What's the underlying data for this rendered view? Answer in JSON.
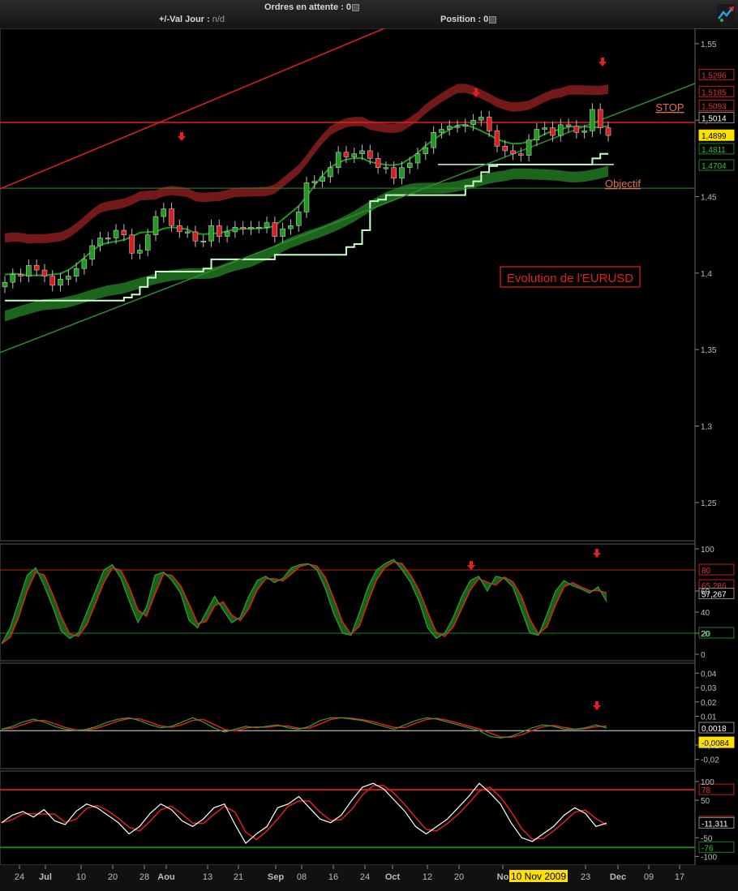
{
  "toolbar": {
    "orders_label": "Ordres en attente :",
    "orders_value": "0",
    "day_change_label": "+/-Val Jour :",
    "day_change_value": "n/d",
    "position_label": "Position :",
    "position_value": "0"
  },
  "colors": {
    "bullish": "#1f9a1f",
    "bearish": "#d42020",
    "stop_line": "#e02020",
    "objective_line": "#2e8b2e",
    "trend_channel_red": "#e02020",
    "trend_channel_green": "#2e8b2e",
    "upper_band": "#7a1a1a",
    "lower_band": "#1f6a1f",
    "step_line": "#c8ffc8"
  },
  "main_panel": {
    "annotations": {
      "stop": "STOP",
      "objective": "Objectif",
      "title_box": "Evolution de l'EURUSD"
    },
    "price_badges": [
      {
        "text": "1,5296",
        "kind": "red"
      },
      {
        "text": "1,5185",
        "kind": "red"
      },
      {
        "text": "1,5093",
        "kind": "red"
      },
      {
        "text": "1,5014",
        "kind": "white"
      },
      {
        "text": "1,4899",
        "kind": "highlight"
      },
      {
        "text": "1,4811",
        "kind": "green"
      },
      {
        "text": "1,4704",
        "kind": "green"
      }
    ]
  },
  "stoch_panel": {
    "badges": [
      {
        "text": "80",
        "kind": "red"
      },
      {
        "text": "65,286",
        "kind": "red"
      },
      {
        "text": "57,267",
        "kind": "white"
      },
      {
        "text": "20",
        "kind": "green"
      }
    ]
  },
  "macd_panel": {
    "badges": [
      {
        "text": "0,0018",
        "kind": "white"
      },
      {
        "text": "-0,0084",
        "kind": "highlight"
      }
    ]
  },
  "cci_panel": {
    "badges": [
      {
        "text": "78",
        "kind": "red"
      },
      {
        "text": "-8,0636",
        "kind": "red"
      },
      {
        "text": "-11,311",
        "kind": "white"
      },
      {
        "text": "-76",
        "kind": "green"
      }
    ]
  },
  "date_highlight": "10 Nov 2009",
  "chart_data": [
    {
      "type": "candlestick",
      "title": "Evolution de l'EURUSD",
      "x_ticks": [
        "24",
        "Jul",
        "10",
        "20",
        "28",
        "Aou",
        "13",
        "21",
        "Sep",
        "08",
        "16",
        "24",
        "Oct",
        "12",
        "20",
        "No",
        "23",
        "Dec",
        "09",
        "17"
      ],
      "y_ticks": [
        "1,55",
        "1,5",
        "1,45",
        "1,4",
        "1,35",
        "1,3",
        "1,25"
      ],
      "ylim": [
        1.225,
        1.56
      ],
      "levels": {
        "stop": 1.4985,
        "objective": 1.4555,
        "support": 1.471
      },
      "close": [
        1.394,
        1.399,
        1.398,
        1.405,
        1.402,
        1.398,
        1.392,
        1.396,
        1.398,
        1.403,
        1.409,
        1.418,
        1.423,
        1.423,
        1.428,
        1.425,
        1.413,
        1.415,
        1.425,
        1.437,
        1.442,
        1.431,
        1.427,
        1.427,
        1.421,
        1.421,
        1.431,
        1.424,
        1.427,
        1.43,
        1.429,
        1.43,
        1.43,
        1.433,
        1.424,
        1.429,
        1.431,
        1.44,
        1.459,
        1.46,
        1.463,
        1.469,
        1.479,
        1.476,
        1.478,
        1.48,
        1.475,
        1.469,
        1.469,
        1.462,
        1.469,
        1.472,
        1.478,
        1.482,
        1.492,
        1.494,
        1.496,
        1.496,
        1.497,
        1.5,
        1.502,
        1.493,
        1.483,
        1.48,
        1.478,
        1.477,
        1.487,
        1.494,
        1.495,
        1.49,
        1.497,
        1.496,
        1.492,
        1.493,
        1.507,
        1.495,
        1.49
      ]
    },
    {
      "type": "line",
      "name": "Stochastic",
      "y_ticks": [
        "100",
        "60",
        "40",
        "20",
        "0"
      ],
      "ylim": [
        0,
        100
      ],
      "levels": [
        80,
        20
      ],
      "values": [
        10,
        25,
        50,
        75,
        82,
        65,
        45,
        22,
        15,
        20,
        40,
        60,
        80,
        85,
        72,
        50,
        30,
        45,
        75,
        78,
        70,
        58,
        32,
        25,
        40,
        55,
        42,
        30,
        35,
        55,
        70,
        74,
        68,
        72,
        82,
        85,
        86,
        80,
        62,
        38,
        20,
        18,
        40,
        64,
        80,
        86,
        90,
        80,
        68,
        50,
        25,
        15,
        20,
        35,
        55,
        70,
        74,
        60,
        74,
        72,
        64,
        42,
        20,
        18,
        38,
        60,
        70,
        65,
        62,
        58,
        64,
        50
      ]
    },
    {
      "type": "line",
      "name": "MACD",
      "y_ticks": [
        "0,04",
        "0,03",
        "0,02",
        "0,01",
        "-0,01",
        "-0,02"
      ],
      "ylim": [
        -0.023,
        0.043
      ],
      "levels": [
        0
      ],
      "values": [
        0.001,
        0.003,
        0.006,
        0.008,
        0.006,
        0.003,
        0.001,
        0,
        0.001,
        0.003,
        0.006,
        0.008,
        0.009,
        0.007,
        0.004,
        0.002,
        0.003,
        0.006,
        0.009,
        0.006,
        0.002,
        -0.001,
        0.001,
        0.003,
        0.002,
        0.003,
        0.004,
        0.002,
        0.001,
        0.003,
        0.007,
        0.009,
        0.009,
        0.008,
        0.007,
        0.005,
        0.003,
        0.001,
        0.004,
        0.007,
        0.009,
        0.008,
        0.006,
        0.004,
        0.002,
        0,
        -0.004,
        -0.005,
        -0.004,
        -0.001,
        0.002,
        0.004,
        0.003,
        0.001,
        0.001,
        0.002,
        0.004,
        0.0018
      ]
    },
    {
      "type": "line",
      "name": "CCI",
      "y_ticks": [
        "100",
        "50",
        "-50",
        "-100"
      ],
      "ylim": [
        -110,
        115
      ],
      "levels": [
        78,
        -76
      ],
      "values": [
        -10,
        10,
        20,
        5,
        25,
        -5,
        -15,
        20,
        40,
        30,
        10,
        -10,
        -40,
        -20,
        15,
        40,
        25,
        -5,
        -20,
        0,
        30,
        40,
        -15,
        -65,
        -40,
        -20,
        30,
        40,
        60,
        30,
        0,
        -10,
        10,
        50,
        85,
        95,
        80,
        50,
        20,
        -20,
        -40,
        -20,
        0,
        30,
        60,
        95,
        70,
        40,
        -10,
        -50,
        -60,
        -40,
        -20,
        10,
        30,
        15,
        -20,
        -11
      ]
    }
  ]
}
